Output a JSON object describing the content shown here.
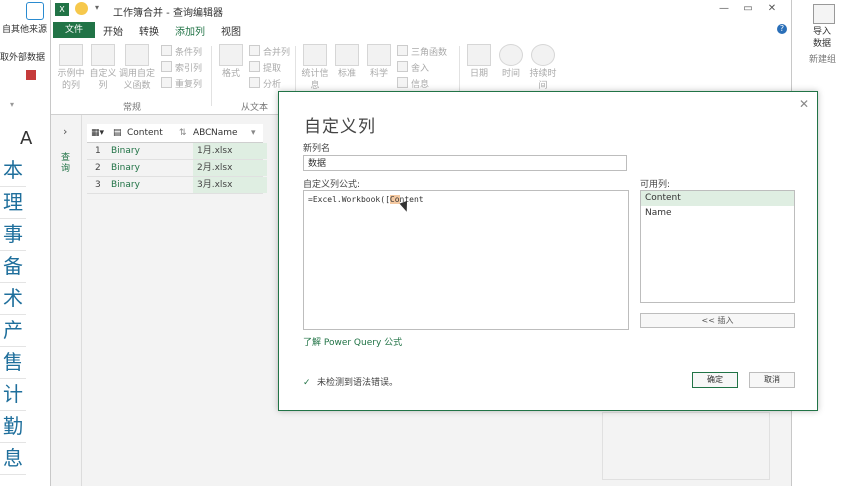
{
  "excel_left": {
    "ext_label1": "自其他来源",
    "ext_label2": "取外部数据",
    "cells": [
      "本",
      "理",
      "事",
      "备",
      "术",
      "产",
      "售",
      "计",
      "勤",
      "息"
    ],
    "col_header": "A"
  },
  "excel_right": {
    "import_label1": "导入",
    "import_label2": "数据",
    "new_label": "新建组"
  },
  "window": {
    "title": "工作簿合并 - 查询编辑器"
  },
  "tabs": {
    "file": "文件",
    "items": [
      "开始",
      "转换",
      "添加列",
      "视图"
    ]
  },
  "ribbon": {
    "group_general": "常规",
    "group_text": "从文本",
    "buttons": {
      "example_col": "示例中的列",
      "custom_col": "自定义列",
      "invoke_func": "调用自定义函数",
      "cond_col": "条件列",
      "index_col": "索引列",
      "dup_col": "重复列",
      "format": "格式",
      "merge_col": "合并列",
      "extract": "提取",
      "parse": "分析",
      "stats": "统计信息",
      "standard": "标准",
      "scientific": "科学",
      "trig": "三角函数",
      "rounding": "舍入",
      "info": "信息",
      "date": "日期",
      "time": "时间",
      "duration": "持续时间"
    }
  },
  "query_pane": {
    "label": "查询"
  },
  "grid": {
    "col1": "Content",
    "col2": "Name",
    "rows": [
      {
        "idx": "1",
        "content": "Binary",
        "name": "1月.xlsx"
      },
      {
        "idx": "2",
        "content": "Binary",
        "name": "2月.xlsx"
      },
      {
        "idx": "3",
        "content": "Binary",
        "name": "3月.xlsx"
      }
    ]
  },
  "dialog": {
    "title": "自定义列",
    "new_col_label": "新列名",
    "new_col_value": "数据",
    "formula_label": "自定义列公式:",
    "formula_prefix": "=Excel.Workbook([",
    "formula_hl": "Co",
    "formula_suffix": "ntent",
    "available_label": "可用列:",
    "available_items": [
      "Content",
      "Name"
    ],
    "insert_label": "<< 插入",
    "learn_link": "了解 Power Query 公式",
    "status_text": "未检测到语法错误。",
    "ok_label": "确定",
    "cancel_label": "取消"
  },
  "colors": {
    "accent": "#217346",
    "selection": "#dfeee2"
  }
}
